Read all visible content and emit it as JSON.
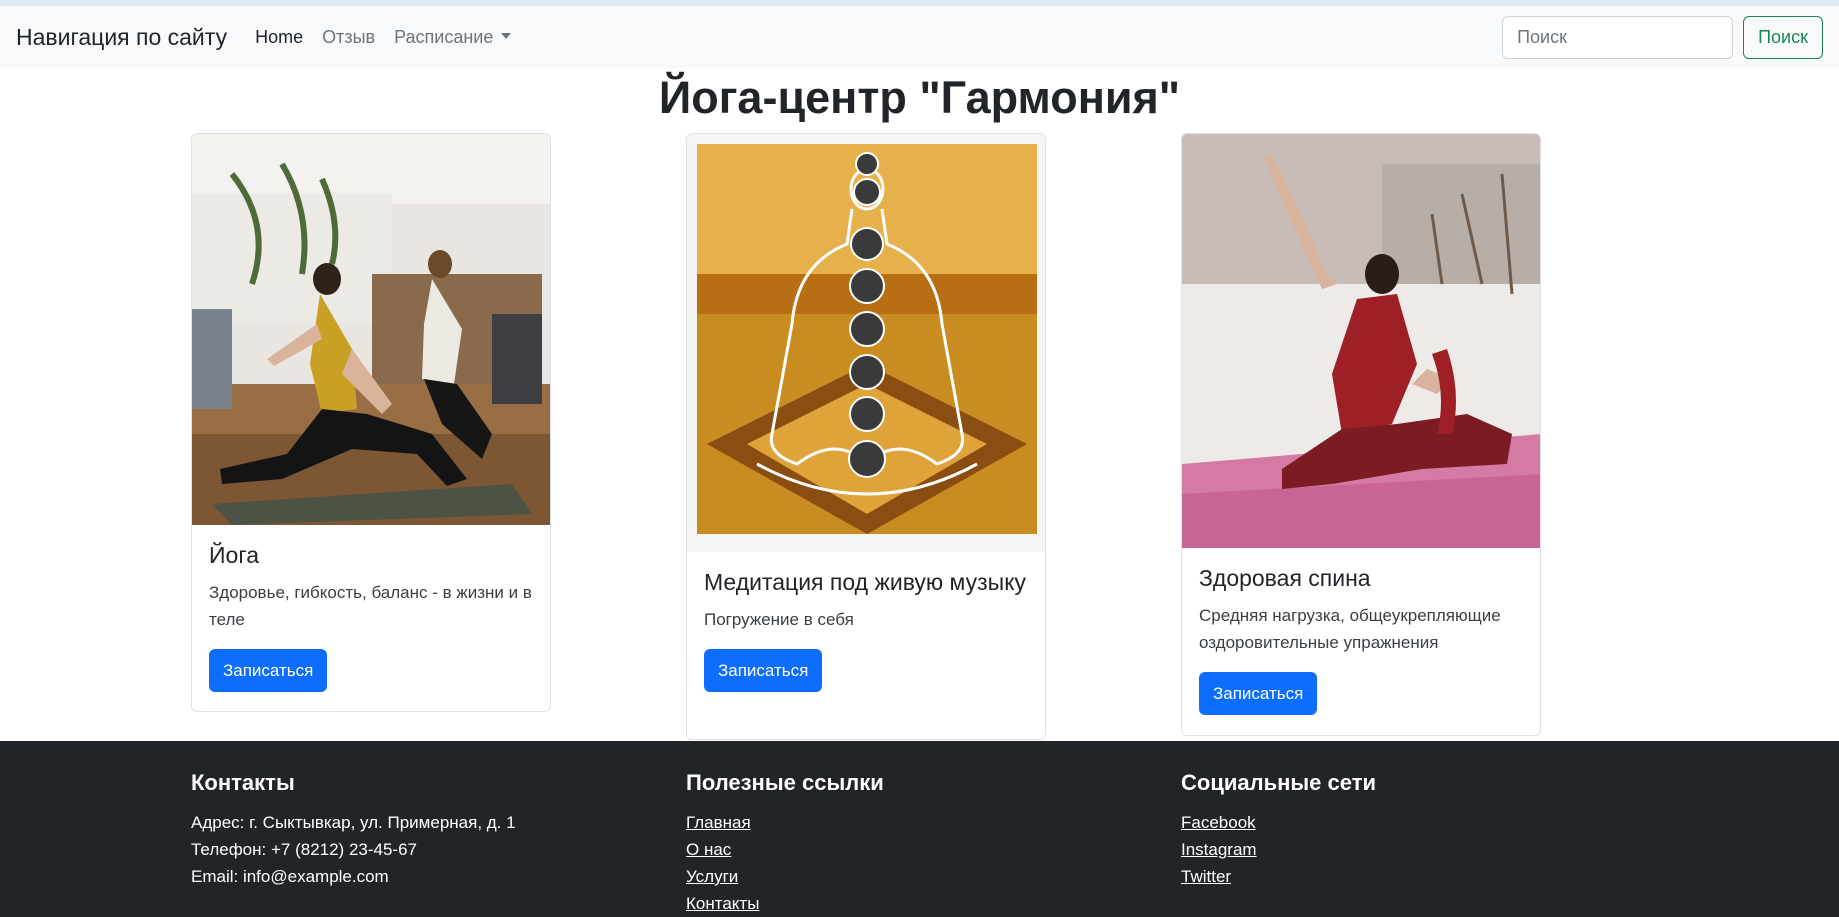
{
  "navbar": {
    "brand": "Навигация по сайту",
    "links": [
      "Home",
      "Отзыв",
      "Расписание"
    ],
    "search_placeholder": "Поиск",
    "search_button": "Поиск"
  },
  "title": "Йога-центр \"Гармония\"",
  "cards": [
    {
      "title": "Йога",
      "text": "Здоровье, гибкость, баланс - в жизни и в теле",
      "button": "Записаться"
    },
    {
      "title": "Медитация под живую музыку",
      "text": "Погружение в себя",
      "button": "Записаться"
    },
    {
      "title": "Здоровая спина",
      "text": "Средняя нагрузка, общеукрепляющие оздоровительные упражнения",
      "button": "Записаться"
    }
  ],
  "footer": {
    "contacts": {
      "heading": "Контакты",
      "address": "Адрес: г. Сыктывкар, ул. Примерная, д. 1",
      "phone": "Телефон: +7 (8212) 23-45-67",
      "email": "Email: info@example.com"
    },
    "links": {
      "heading": "Полезные ссылки",
      "items": [
        "Главная",
        "О нас",
        "Услуги",
        "Контакты"
      ]
    },
    "social": {
      "heading": "Социальные сети",
      "items": [
        "Facebook",
        "Instagram",
        "Twitter"
      ]
    }
  },
  "colors": {
    "primary": "#0d6efd",
    "success": "#198754",
    "navbar_bg": "#f8f9fa",
    "footer_bg": "#212529"
  }
}
